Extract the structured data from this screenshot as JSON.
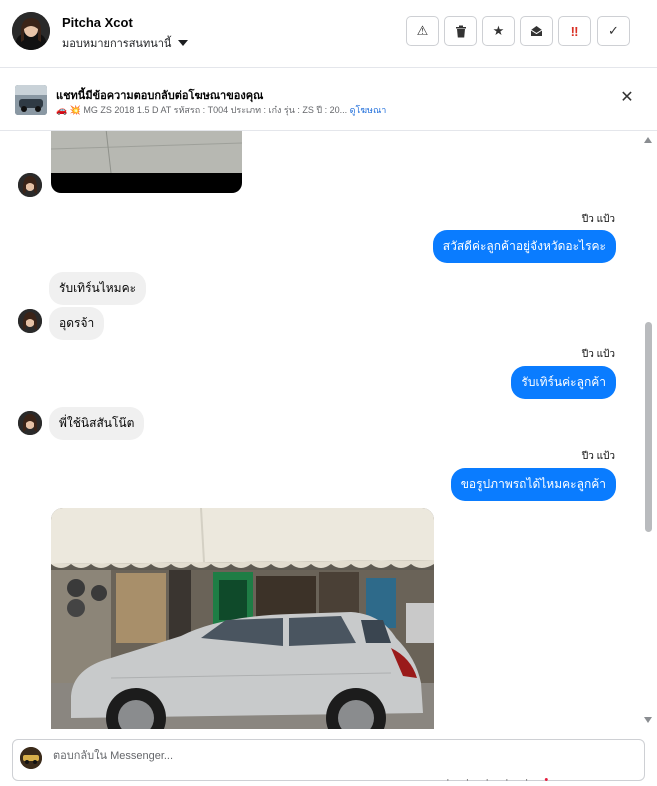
{
  "header": {
    "name": "Pitcha Xcot",
    "assign_label": "มอบหมายการสนทนานี้",
    "buttons": [
      {
        "name": "report-button",
        "icon": "warning-icon",
        "glyph": "⚠"
      },
      {
        "name": "delete-button",
        "icon": "trash-icon",
        "glyph": "🗑"
      },
      {
        "name": "star-button",
        "icon": "star-icon",
        "glyph": "★"
      },
      {
        "name": "mark-unread-button",
        "icon": "envelope-open-icon",
        "glyph": "✉"
      },
      {
        "name": "important-button",
        "icon": "exclamation-icon",
        "glyph": "‼"
      },
      {
        "name": "done-button",
        "icon": "check-icon",
        "glyph": "✓"
      }
    ]
  },
  "ad": {
    "title": "แชทนี้มีข้อความตอบกลับต่อโฆษณาของคุณ",
    "subtitle": "🚗 💥 MG ZS 2018 1.5 D AT รหัสรถ : T004 ประเภท : เก๋ง รุ่น : ZS ปี : 20...",
    "link": "ดูโฆษณา",
    "close": "✕"
  },
  "messages": {
    "seen": "ปีว แป้ว",
    "out1": "สวัสดีค่ะลูกค้าอยู่จังหวัดอะไรคะ",
    "in1": "รับเทิร์นไหมคะ",
    "in2": "อุดรจ้า",
    "out2": "รับเทิร์นค่ะลูกค้า",
    "in3": "พี่ใช้นิสสันโน๊ต",
    "out3": "ขอรูปภาพรถได้ไหมคะลูกค้า"
  },
  "composer": {
    "placeholder": "ตอบกลับใน Messenger..."
  },
  "colors": {
    "accent": "#0a7cff",
    "link": "#216fdb",
    "incoming_bubble": "#f0f0f0"
  }
}
